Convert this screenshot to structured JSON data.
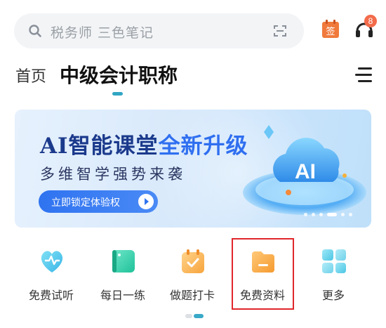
{
  "search": {
    "placeholder": "税务师 三色笔记"
  },
  "notification_badge": "8",
  "sign_in_icon_text": "签",
  "tabs": {
    "home": "首页",
    "active": "中级会计职称"
  },
  "banner": {
    "title_part1": "AI智能课堂",
    "title_part2": "全新升级",
    "subtitle": "多维智学强势来袭",
    "button_label": "立即锁定体验权",
    "art_text": "AI"
  },
  "shortcuts": [
    {
      "label": "免费试听",
      "icon": "heartbeat-icon"
    },
    {
      "label": "每日一练",
      "icon": "book-icon"
    },
    {
      "label": "做题打卡",
      "icon": "calendar-check-icon"
    },
    {
      "label": "免费资料",
      "icon": "folder-icon"
    },
    {
      "label": "更多",
      "icon": "grid-icon"
    }
  ],
  "colors": {
    "accent": "#32a6c3",
    "banner_button": "#2f73f0",
    "highlight": "#e0262b",
    "badge": "#f26b4a"
  }
}
